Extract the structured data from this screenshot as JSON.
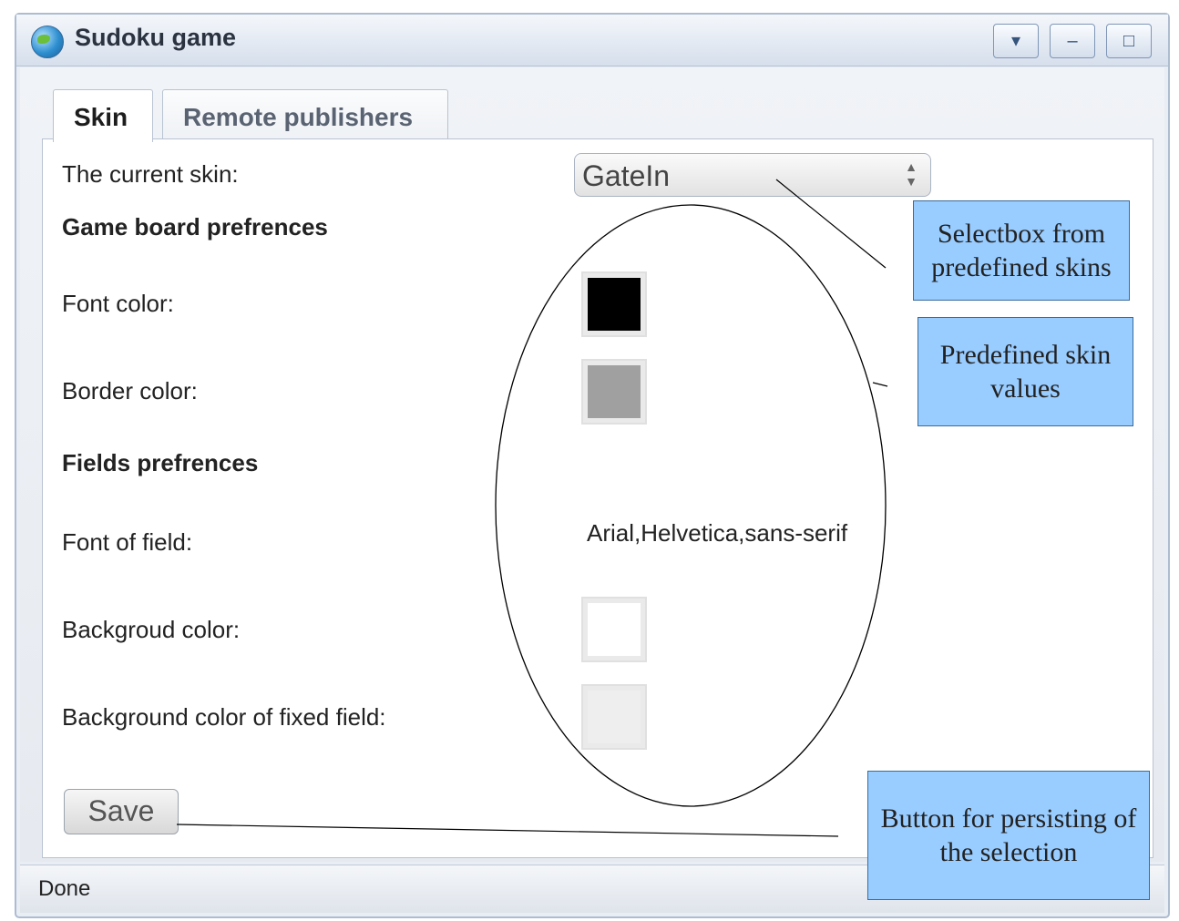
{
  "window": {
    "title": "Sudoku game",
    "buttons": {
      "menu": "▾",
      "minimize": "–",
      "maximize": "□"
    }
  },
  "tabs": [
    {
      "label": "Skin",
      "active": true
    },
    {
      "label": "Remote publishers",
      "active": false
    }
  ],
  "form": {
    "current_skin_label": "The current skin:",
    "current_skin_value": "GateIn",
    "game_board_header": "Game board prefrences",
    "font_color_label": "Font color:",
    "font_color": "#000000",
    "border_color_label": "Border color:",
    "border_color": "#a0a0a0",
    "fields_header": "Fields prefrences",
    "font_of_field_label": "Font of field:",
    "font_of_field_value": "Arial,Helvetica,sans-serif",
    "background_color_label": "Backgroud color:",
    "background_color": "#ffffff",
    "fixed_field_bg_label": "Background color of fixed field:",
    "fixed_field_bg_color": "#eeeeee",
    "save_label": "Save"
  },
  "status": {
    "text": "Done"
  },
  "annotations": {
    "selectbox": "Selectbox from predefined skins",
    "values": "Predefined skin values",
    "button": "Button for persisting of the selection"
  }
}
